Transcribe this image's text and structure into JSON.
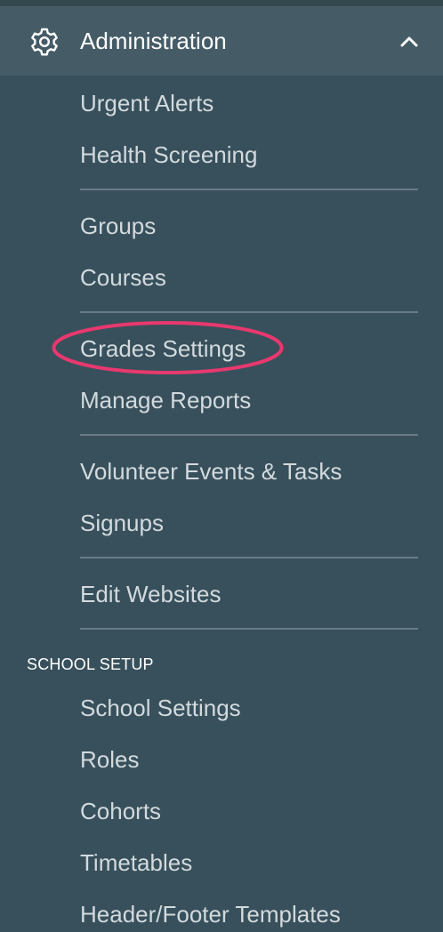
{
  "section": {
    "title": "Administration",
    "icon": "gear-icon",
    "toggle_icon": "chevron-up-icon"
  },
  "items": {
    "urgent_alerts": "Urgent Alerts",
    "health_screening": "Health Screening",
    "groups": "Groups",
    "courses": "Courses",
    "grades_settings": "Grades Settings",
    "manage_reports": "Manage Reports",
    "volunteer_events": "Volunteer Events & Tasks",
    "signups": "Signups",
    "edit_websites": "Edit Websites"
  },
  "school_setup": {
    "label": "SCHOOL SETUP",
    "items": {
      "school_settings": "School Settings",
      "roles": "Roles",
      "cohorts": "Cohorts",
      "timetables": "Timetables",
      "header_footer_templates": "Header/Footer Templates"
    }
  },
  "colors": {
    "background": "#38505b",
    "header_background": "#455c67",
    "item_text": "#d2dade",
    "highlight": "#e8386f"
  }
}
